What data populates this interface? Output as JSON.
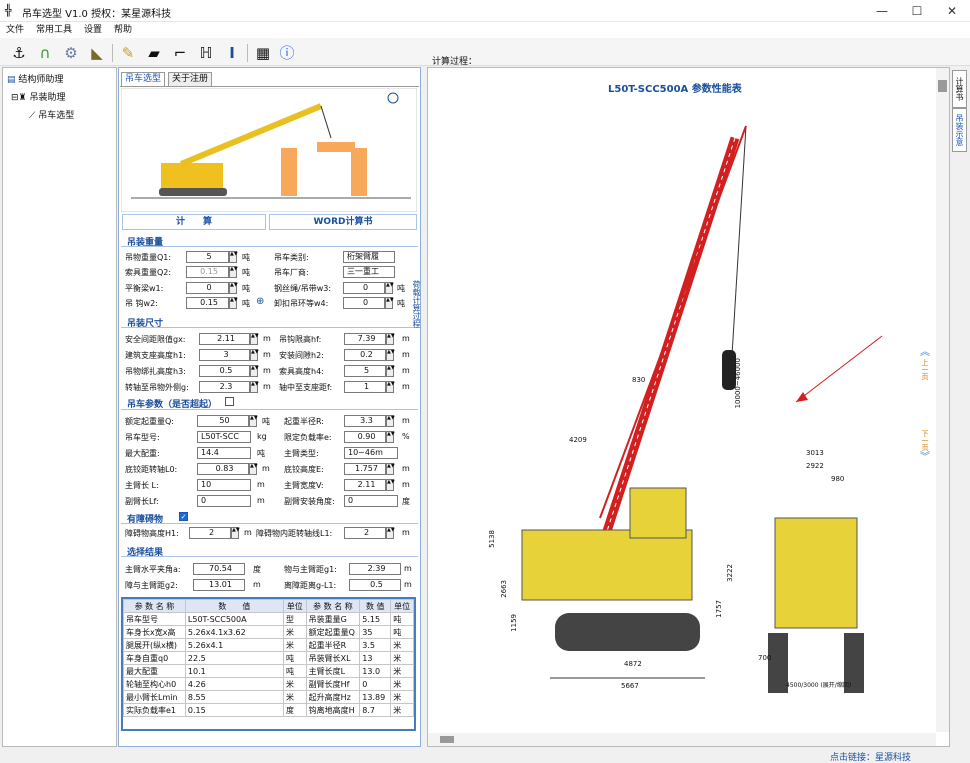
{
  "window": {
    "title": "吊车选型 V1.0 授权：某星源科技"
  },
  "menu": [
    "文件",
    "常用工具",
    "设置",
    "帮助"
  ],
  "process_label": "计算过程：",
  "tree": {
    "root": "结构师助理",
    "child": "吊装助理",
    "leaf": "吊车选型"
  },
  "tabs": [
    "吊车选型",
    "关于注册"
  ],
  "buttons": {
    "calc": "计　　算",
    "word": "WORD计算书"
  },
  "vertical_tab": "荷载计算过程",
  "sections": {
    "weight": "吊装重量",
    "size": "吊装尺寸",
    "crane": "吊车参数（是否超起）",
    "obstacle": "有障碍物",
    "result": "选择结果"
  },
  "weight_fields": {
    "q1": {
      "label": "吊物重量Q1:",
      "value": "5",
      "unit": "吨"
    },
    "q2": {
      "label": "索具重量Q2:",
      "value": "0.15",
      "unit": "吨"
    },
    "w1": {
      "label": "平衡梁w1:",
      "value": "0",
      "unit": "吨"
    },
    "w2": {
      "label": "吊 钩w2:",
      "value": "0.15",
      "unit": "吨"
    },
    "type": {
      "label": "吊车类别:",
      "value": "桁架臂履"
    },
    "maker": {
      "label": "吊车厂商:",
      "value": "三一重工"
    },
    "w3": {
      "label": "钢丝绳/吊带w3:",
      "value": "0",
      "unit": "吨"
    },
    "w4": {
      "label": "卸扣吊环等w4:",
      "value": "0",
      "unit": "吨"
    }
  },
  "size_fields": {
    "gx": {
      "label": "安全间距限值gx:",
      "value": "2.11",
      "unit": "m"
    },
    "hf": {
      "label": "吊钩限高hf:",
      "value": "7.39",
      "unit": "m"
    },
    "h1": {
      "label": "建筑支座高度h1:",
      "value": "3",
      "unit": "m"
    },
    "h2": {
      "label": "安装间隙h2:",
      "value": "0.2",
      "unit": "m"
    },
    "h3": {
      "label": "吊物绑扎高度h3:",
      "value": "0.5",
      "unit": "m"
    },
    "h4": {
      "label": "索具高度h4:",
      "value": "5",
      "unit": "m"
    },
    "g": {
      "label": "转轴至吊物外侧g:",
      "value": "2.3",
      "unit": "m"
    },
    "f": {
      "label": "轴中至支座距f:",
      "value": "1",
      "unit": "m"
    }
  },
  "crane_fields": {
    "q": {
      "label": "额定起重量Q:",
      "value": "50",
      "unit": "吨"
    },
    "r": {
      "label": "起重半径R:",
      "value": "3.3",
      "unit": "m"
    },
    "model": {
      "label": "吊车型号:",
      "value": "L50T-SCC",
      "unit": "kg"
    },
    "e": {
      "label": "限定负载率e:",
      "value": "0.90",
      "unit": "%"
    },
    "cw": {
      "label": "最大配重:",
      "value": "14.4",
      "unit": "吨"
    },
    "boom": {
      "label": "主臂类型:",
      "value": "10~46m"
    },
    "l0": {
      "label": "底铰距转轴L0:",
      "value": "0.83",
      "unit": "m"
    },
    "e_h": {
      "label": "底铰高度E:",
      "value": "1.757",
      "unit": "m"
    },
    "l": {
      "label": "主臂长 L:",
      "value": "10",
      "unit": "m"
    },
    "v": {
      "label": "主臂宽度V:",
      "value": "2.11",
      "unit": "m"
    },
    "lf": {
      "label": "副臂长Lf:",
      "value": "0",
      "unit": "m"
    },
    "angle": {
      "label": "副臂安装角度:",
      "value": "0",
      "unit": "度"
    }
  },
  "obstacle_fields": {
    "h1": {
      "label": "障碍物高度H1:",
      "value": "2",
      "unit": "m"
    },
    "l1": {
      "label": "障碍物内距转轴线L1:",
      "value": "2",
      "unit": "m"
    }
  },
  "result_fields": {
    "a": {
      "label": "主臂水平夹角a:",
      "value": "70.54",
      "unit": "度"
    },
    "g1": {
      "label": "物与主臂距g1:",
      "value": "2.39",
      "unit": "m"
    },
    "g2": {
      "label": "障与主臂距g2:",
      "value": "13.01",
      "unit": "m"
    },
    "l1": {
      "label": "离障距离g-L1:",
      "value": "0.5",
      "unit": "m"
    }
  },
  "param_table": {
    "headers": [
      "参 数 名 称",
      "数　　值",
      "单位",
      "参 数 名 称",
      "数 值",
      "单位"
    ],
    "rows": [
      [
        "吊车型号",
        "L50T-SCC500A",
        "型",
        "吊装重量G",
        "5.15",
        "吨"
      ],
      [
        "车身长x宽x高",
        "5.26x4.1x3.62",
        "米",
        "额定起重量Q",
        "35",
        "吨"
      ],
      [
        "腿展开(纵x横)",
        "5.26x4.1",
        "米",
        "起重半径R",
        "3.5",
        "米"
      ],
      [
        "车身自重q0",
        "22.5",
        "吨",
        "吊装臂长XL",
        "13",
        "米"
      ],
      [
        "最大配重",
        "10.1",
        "吨",
        "主臂长度L",
        "13.0",
        "米"
      ],
      [
        "轮轴至构心h0",
        "4.26",
        "米",
        "副臂长度Hf",
        "0",
        "米"
      ],
      [
        "最小臂长Lmin",
        "8.55",
        "米",
        "起升高度Hz",
        "13.89",
        "米"
      ],
      [
        "实际负载率e1",
        "0.15",
        "度",
        "钩离地高度H",
        "8.7",
        "米"
      ]
    ]
  },
  "doc": {
    "title": "L50T-SCC500A 参数性能表"
  },
  "dims": {
    "d830": "830",
    "d4209": "4209",
    "d5138": "5138",
    "d2663": "2663",
    "d1159": "1159",
    "d4872": "4872",
    "d5667": "5667",
    "d3222": "3222",
    "d1757": "1757",
    "dboom": "10000~46000",
    "d3013": "3013",
    "d2922": "2922",
    "d980": "980",
    "d700": "700",
    "dtrack": "4500/3000 (展开/缩回)"
  },
  "right_tabs": [
    "计算书",
    "吊装示意"
  ],
  "nav": {
    "prev": "上一页",
    "next": "下一页"
  },
  "status": {
    "link": "点击链接：星源科技"
  }
}
